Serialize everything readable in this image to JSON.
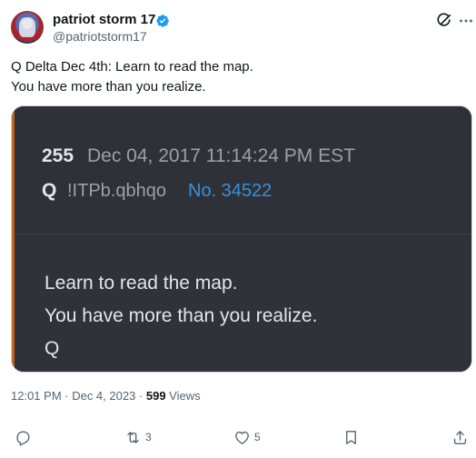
{
  "author": {
    "display_name": "patriot storm 17",
    "handle": "@patriotstorm17",
    "verified_color": "#1d9bf0"
  },
  "icons": {
    "grok": "grok-icon",
    "more": "more-icon",
    "reply": "reply-icon",
    "retweet": "retweet-icon",
    "like": "heart-icon",
    "bookmark": "bookmark-icon",
    "share": "share-icon"
  },
  "tweet": {
    "lines": [
      "Q Delta Dec 4th: Learn to read the map.",
      "You have more than you realize."
    ]
  },
  "media": {
    "post_number": "255",
    "post_date": "Dec 04, 2017 11:14:24 PM EST",
    "q_label": "Q",
    "tripcode": "!ITPb.qbhqo",
    "post_no": "No. 34522",
    "body_lines": [
      "Learn to read the map.",
      "You have more than you realize.",
      "Q"
    ],
    "colors": {
      "accent": "#c4621c",
      "link": "#3b8fd6",
      "background": "#2e3238"
    }
  },
  "meta": {
    "time_date": "12:01 PM · Dec 4, 2023 · ",
    "views_count": "599",
    "views_label": " Views"
  },
  "actions": {
    "reply_count": "",
    "retweet_count": "3",
    "like_count": "5"
  }
}
